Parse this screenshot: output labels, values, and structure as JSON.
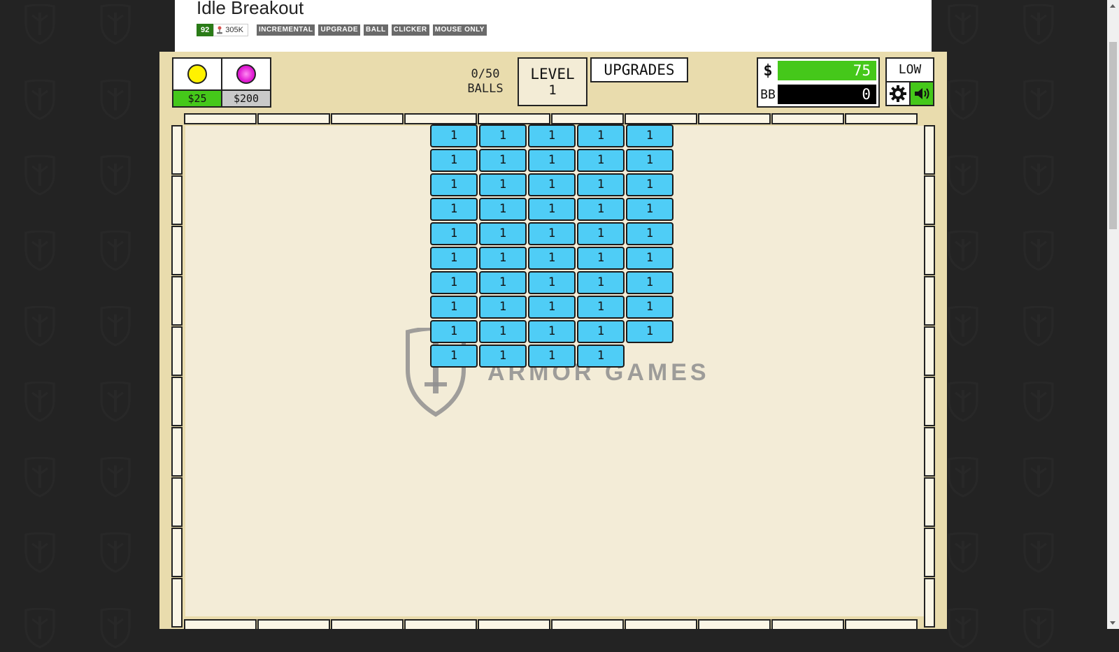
{
  "page": {
    "title": "Idle Breakout",
    "rating": "92",
    "plays": "305K",
    "tags": [
      "INCREMENTAL",
      "UPGRADE",
      "BALL",
      "CLICKER",
      "MOUSE ONLY"
    ]
  },
  "hud": {
    "ball_shop": [
      {
        "price": "$25",
        "ball_color": "#fff200",
        "price_bg": "#45c81a"
      },
      {
        "price": "$200",
        "ball_color": "#e01ad3",
        "price_bg": "#c9c9c9"
      }
    ],
    "balls_count": "0/50",
    "balls_label": "BALLS",
    "level_label": "LEVEL",
    "level_value": "1",
    "upgrades_label": "UPGRADES",
    "money_symbol": "$",
    "money_value": "75",
    "bb_symbol": "BB",
    "bb_value": "0",
    "quality_label": "LOW",
    "settings_icon": "gear-icon",
    "sound_icon": "speaker-icon"
  },
  "colors": {
    "money_bar": "#45c81a",
    "bb_bar": "#000000",
    "brick": "#4fcdf6",
    "sound_button": "#45c81a"
  },
  "watermark": "ARMOR GAMES",
  "brick_grid": {
    "rows": [
      [
        1,
        1,
        1,
        1,
        1
      ],
      [
        1,
        1,
        1,
        1,
        1
      ],
      [
        1,
        1,
        1,
        1,
        1
      ],
      [
        1,
        1,
        1,
        1,
        1
      ],
      [
        1,
        1,
        1,
        1,
        1
      ],
      [
        1,
        1,
        1,
        1,
        1
      ],
      [
        1,
        1,
        1,
        1,
        1
      ],
      [
        1,
        1,
        1,
        1,
        1
      ],
      [
        1,
        1,
        1,
        1,
        1
      ],
      [
        1,
        1,
        1,
        1
      ]
    ]
  }
}
